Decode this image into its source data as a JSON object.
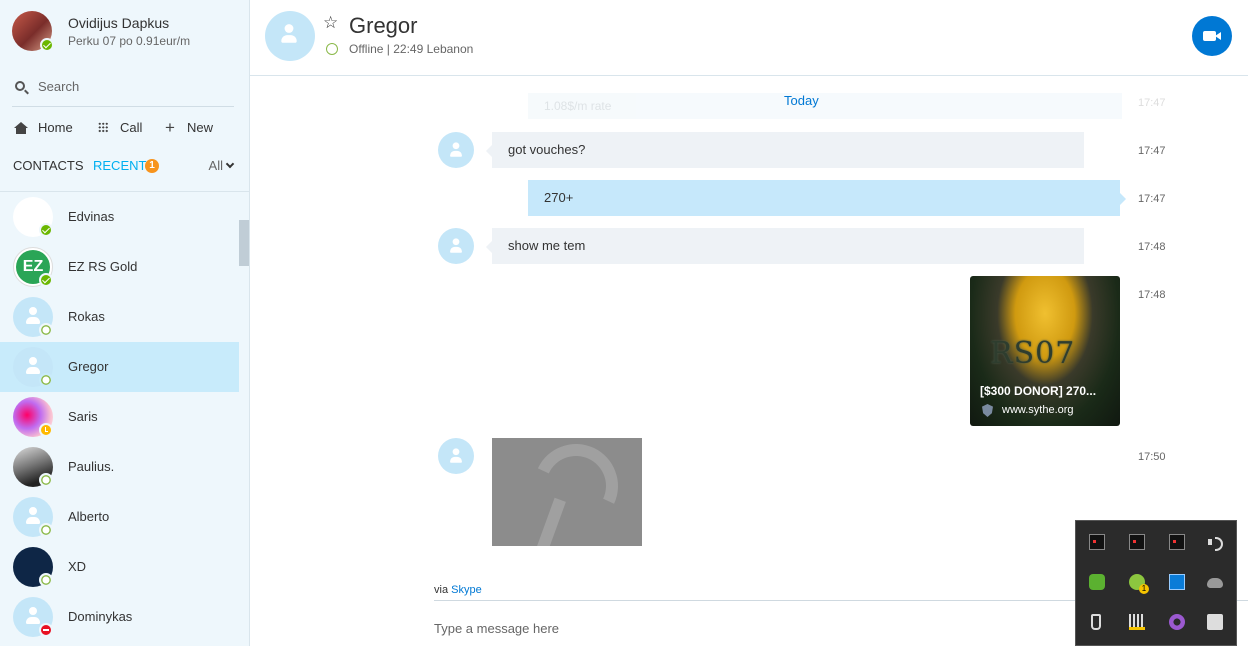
{
  "profile": {
    "name": "Ovidijus Dapkus",
    "mood": "Perku 07 po 0.91eur/m"
  },
  "search": {
    "placeholder": "Search"
  },
  "nav": {
    "home": "Home",
    "call": "Call",
    "new": "New"
  },
  "tabs": {
    "contacts": "CONTACTS",
    "recent": "RECENT",
    "recent_badge": "1",
    "filter": "All"
  },
  "contacts": [
    {
      "name": "Edvinas",
      "status": "online"
    },
    {
      "name": "EZ RS Gold",
      "status": "online",
      "avatar_text": "EZ"
    },
    {
      "name": "Rokas",
      "status": "offline"
    },
    {
      "name": "Gregor",
      "status": "offline",
      "selected": true
    },
    {
      "name": "Saris",
      "status": "away"
    },
    {
      "name": "Paulius.",
      "status": "offline"
    },
    {
      "name": "Alberto",
      "status": "offline"
    },
    {
      "name": "XD",
      "status": "offline"
    },
    {
      "name": "Dominykas",
      "status": "dnd"
    }
  ],
  "header": {
    "name": "Gregor",
    "status": "Offline | 22:49 Lebanon"
  },
  "chat": {
    "faded_text": "1.08$/m rate",
    "faded_time": "17:47",
    "date_label": "Today",
    "messages": [
      {
        "direction": "in",
        "text": "got vouches?",
        "time": "17:47"
      },
      {
        "direction": "out",
        "text": "270+",
        "time": "17:47"
      },
      {
        "direction": "in",
        "text": "show me tem",
        "time": "17:48"
      },
      {
        "direction": "out",
        "type": "link",
        "title": "[$300 DONOR] 270...",
        "url": "www.sythe.org",
        "image_text": "RS07",
        "time": "17:48"
      },
      {
        "direction": "in",
        "type": "image",
        "time": "17:50"
      }
    ],
    "via_prefix": "via",
    "via_link": "Skype",
    "compose_placeholder": "Type a message here"
  },
  "colors": {
    "accent": "#00aff0",
    "link": "#0078d4",
    "selected_bg": "#c8ebfb",
    "badge": "#f7941d",
    "online": "#6bb700"
  },
  "tray_icons": [
    "app-icon",
    "app-icon",
    "app-icon",
    "volume-icon",
    "nvidia-icon",
    "update-icon",
    "network-icon",
    "onedrive-icon",
    "usb-icon",
    "keyboard-icon",
    "vpn-icon",
    "app-icon"
  ]
}
